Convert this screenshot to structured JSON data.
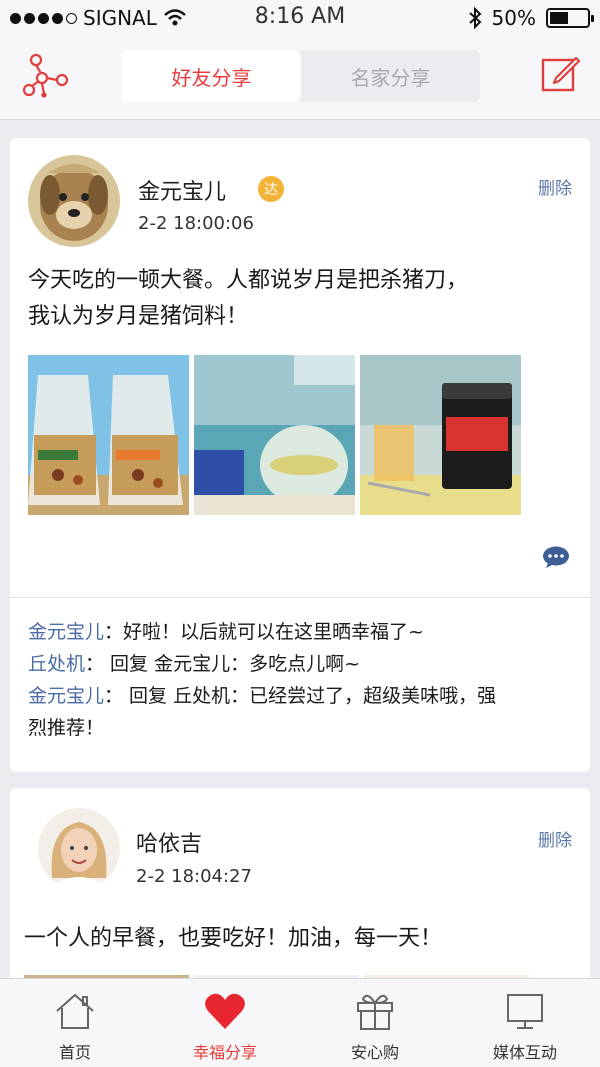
{
  "status_bar": {
    "carrier": "SIGNAL",
    "time": "8:16 AM",
    "battery": "50%",
    "battery_level": 0.5,
    "icons": [
      "wifi-icon",
      "bluetooth-icon",
      "battery-icon"
    ]
  },
  "nav": {
    "tabs": [
      {
        "label": "好友分享",
        "active": true
      },
      {
        "label": "名家分享",
        "active": false
      }
    ],
    "left_icon": "share-network-icon",
    "right_icon": "compose-icon"
  },
  "posts": [
    {
      "author": "金元宝儿",
      "badge": "达",
      "time": "2-2  18:00:06",
      "delete_label": "删除",
      "text_lines": [
        "今天吃的一顿大餐。人都说岁月是把杀猪刀，",
        "我认为岁月是猪饲料！"
      ],
      "comments": [
        {
          "name": "金元宝儿",
          "text": "：好啦！以后就可以在这里晒幸福了~"
        },
        {
          "name": "丘处机",
          "text": "：  回复 金元宝儿：多吃点儿啊~"
        },
        {
          "name": "金元宝儿",
          "text": "：  回复 丘处机：已经尝过了，超级美味哦，强"
        },
        {
          "name": "",
          "text": "烈推荐！"
        }
      ]
    },
    {
      "author": "哈依吉",
      "time": "2-2  18:04:27",
      "delete_label": "删除",
      "text_lines": [
        "一个人的早餐，也要吃好！加油，每一天！"
      ]
    }
  ],
  "tabbar": [
    {
      "label": "首页",
      "icon": "home-icon",
      "active": false
    },
    {
      "label": "幸福分享",
      "icon": "heart-icon",
      "active": true
    },
    {
      "label": "安心购",
      "icon": "gift-icon",
      "active": false
    },
    {
      "label": "媒体互动",
      "icon": "monitor-icon",
      "active": false
    }
  ],
  "colors": {
    "accent": "#e83c3c",
    "link": "#4a6ca4",
    "badge": "#f2b336"
  }
}
